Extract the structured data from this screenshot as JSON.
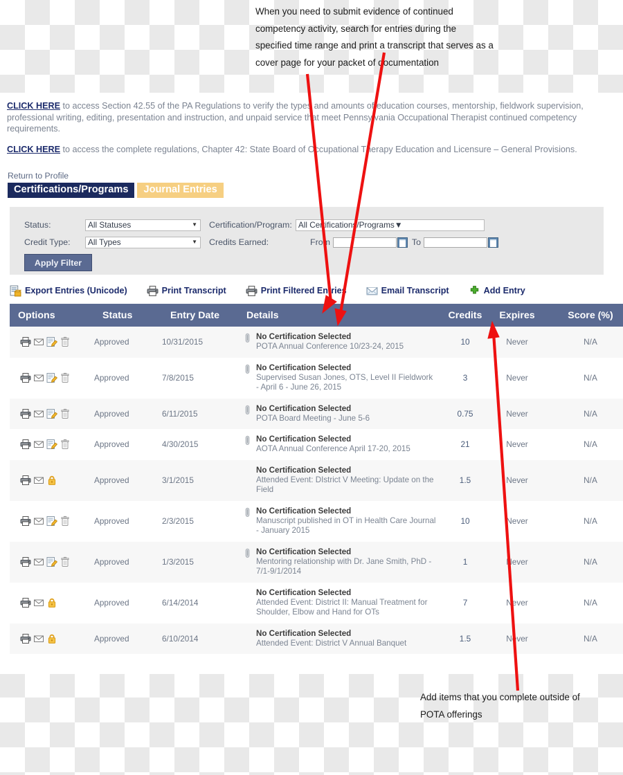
{
  "annotations": {
    "top": "When you need to submit evidence of continued competency activity, search for entries during the specified time range and print a transcript that serves as a cover page for your packet of documentation",
    "bottom": "Add items that you complete outside of POTA offerings"
  },
  "intro": {
    "p1_link": "CLICK HERE",
    "p1_text": " to access Section 42.55 of the PA Regulations to verify the types and amounts of education courses, mentorship, fieldwork supervision, professional writing, editing, presentation and instruction, and unpaid service that meet Pennsylvania Occupational Therapist continued competency requirements.",
    "p2_link": "CLICK HERE",
    "p2_text": " to access the complete regulations, Chapter 42: State Board of Occupational Therapy Education and Licensure – General Provisions."
  },
  "nav": {
    "return_to_profile": "Return to Profile",
    "tabs": [
      {
        "label": "Certifications/Programs",
        "active": true
      },
      {
        "label": "Journal Entries",
        "active": false
      }
    ]
  },
  "filter": {
    "status_label": "Status:",
    "status_value": "All Statuses",
    "cert_label": "Certification/Program:",
    "cert_value": "All Certifications/Programs",
    "credit_type_label": "Credit Type:",
    "credit_type_value": "All Types",
    "credits_earned_label": "Credits Earned:",
    "from_label": "From",
    "from_value": "",
    "to_label": "To",
    "to_value": "",
    "apply_label": "Apply Filter",
    "panel_bg": "#e8e8e8",
    "button_color": "#5a6a92"
  },
  "toolbar": [
    {
      "label": "Export Entries (Unicode)",
      "icon": "export-icon"
    },
    {
      "label": "Print Transcript",
      "icon": "printer-icon"
    },
    {
      "label": "Print Filtered Entries",
      "icon": "printer-icon"
    },
    {
      "label": "Email Transcript",
      "icon": "envelope-icon"
    },
    {
      "label": "Add Entry",
      "icon": "plus-icon"
    }
  ],
  "table": {
    "header_bg": "#5a6a92",
    "columns": [
      "Options",
      "Status",
      "Entry Date",
      "Details",
      "Credits",
      "Expires",
      "Score (%)"
    ],
    "rows": [
      {
        "icons": [
          "print-icon",
          "email-icon",
          "edit-icon",
          "delete-icon"
        ],
        "status": "Approved",
        "date": "10/31/2015",
        "attachment": true,
        "title": "No Certification Selected",
        "detail": "POTA Annual Conference 10/23-24, 2015",
        "credits": "10",
        "expires": "Never",
        "score": "N/A"
      },
      {
        "icons": [
          "print-icon",
          "email-icon",
          "edit-icon",
          "delete-icon"
        ],
        "status": "Approved",
        "date": "7/8/2015",
        "attachment": true,
        "title": "No Certification Selected",
        "detail": "Supervised Susan Jones, OTS, Level II Fieldwork - April 6 - June 26, 2015",
        "credits": "3",
        "expires": "Never",
        "score": "N/A"
      },
      {
        "icons": [
          "print-icon",
          "email-icon",
          "edit-icon",
          "delete-icon"
        ],
        "status": "Approved",
        "date": "6/11/2015",
        "attachment": true,
        "title": "No Certification Selected",
        "detail": "POTA Board Meeting - June 5-6",
        "credits": "0.75",
        "expires": "Never",
        "score": "N/A"
      },
      {
        "icons": [
          "print-icon",
          "email-icon",
          "edit-icon",
          "delete-icon"
        ],
        "status": "Approved",
        "date": "4/30/2015",
        "attachment": true,
        "title": "No Certification Selected",
        "detail": "AOTA Annual Conference April 17-20, 2015",
        "credits": "21",
        "expires": "Never",
        "score": "N/A"
      },
      {
        "icons": [
          "print-icon",
          "email-icon",
          "lock-icon"
        ],
        "status": "Approved",
        "date": "3/1/2015",
        "attachment": false,
        "title": "No Certification Selected",
        "detail": "Attended Event: DIstrict V Meeting: Update on the Field",
        "credits": "1.5",
        "expires": "Never",
        "score": "N/A"
      },
      {
        "icons": [
          "print-icon",
          "email-icon",
          "edit-icon",
          "delete-icon"
        ],
        "status": "Approved",
        "date": "2/3/2015",
        "attachment": true,
        "title": "No Certification Selected",
        "detail": "Manuscript published in OT in Health Care Journal - January 2015",
        "credits": "10",
        "expires": "Never",
        "score": "N/A"
      },
      {
        "icons": [
          "print-icon",
          "email-icon",
          "edit-icon",
          "delete-icon"
        ],
        "status": "Approved",
        "date": "1/3/2015",
        "attachment": true,
        "title": "No Certification Selected",
        "detail": "Mentoring relationship with Dr. Jane Smith, PhD - 7/1-9/1/2014",
        "credits": "1",
        "expires": "Never",
        "score": "N/A"
      },
      {
        "icons": [
          "print-icon",
          "email-icon",
          "lock-icon"
        ],
        "status": "Approved",
        "date": "6/14/2014",
        "attachment": false,
        "title": "No Certification Selected",
        "detail": "Attended Event: District II: Manual Treatment for Shoulder, Elbow and Hand for OTs",
        "credits": "7",
        "expires": "Never",
        "score": "N/A"
      },
      {
        "icons": [
          "print-icon",
          "email-icon",
          "lock-icon"
        ],
        "status": "Approved",
        "date": "6/10/2014",
        "attachment": false,
        "title": "No Certification Selected",
        "detail": "Attended Event: District V Annual Banquet",
        "credits": "1.5",
        "expires": "Never",
        "score": "N/A"
      }
    ]
  }
}
